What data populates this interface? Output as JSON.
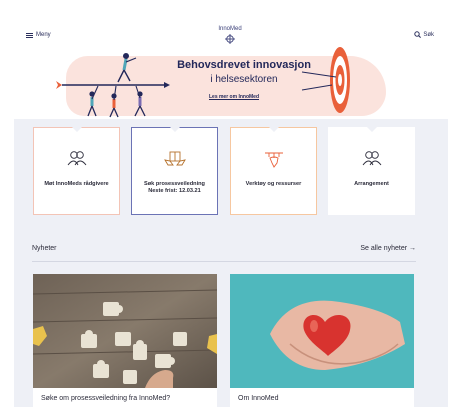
{
  "header": {
    "menu_label": "Meny",
    "logo_text": "InnoMed",
    "search_label": "Søk"
  },
  "hero": {
    "title": "Behovsdrevet innovasjon",
    "subtitle": "i helsesektoren",
    "link": "Les mer om InnoMed"
  },
  "cards": [
    {
      "label": "Møt InnoMeds rådgivere",
      "icon": "people-icon"
    },
    {
      "label_line1": "Søk prosessveiledning",
      "label_line2": "Neste frist: 12.03.21",
      "icon": "hands-box-icon"
    },
    {
      "label": "Verktøy og ressurser",
      "icon": "hand-tools-icon"
    },
    {
      "label": "Arrangement",
      "icon": "people-icon"
    }
  ],
  "news": {
    "title": "Nyheter",
    "see_all": "Se alle nyheter →",
    "items": [
      {
        "caption": "Søke om prosessveiledning fra InnoMed?"
      },
      {
        "caption": "Om InnoMed"
      }
    ]
  },
  "colors": {
    "brand_navy": "#23285a",
    "hero_blush": "#fbe3dd",
    "target_orange": "#e9603a",
    "card_selected_border": "#6b73b5",
    "news_teal": "#4fb8bd",
    "heart_red": "#d8332f"
  }
}
